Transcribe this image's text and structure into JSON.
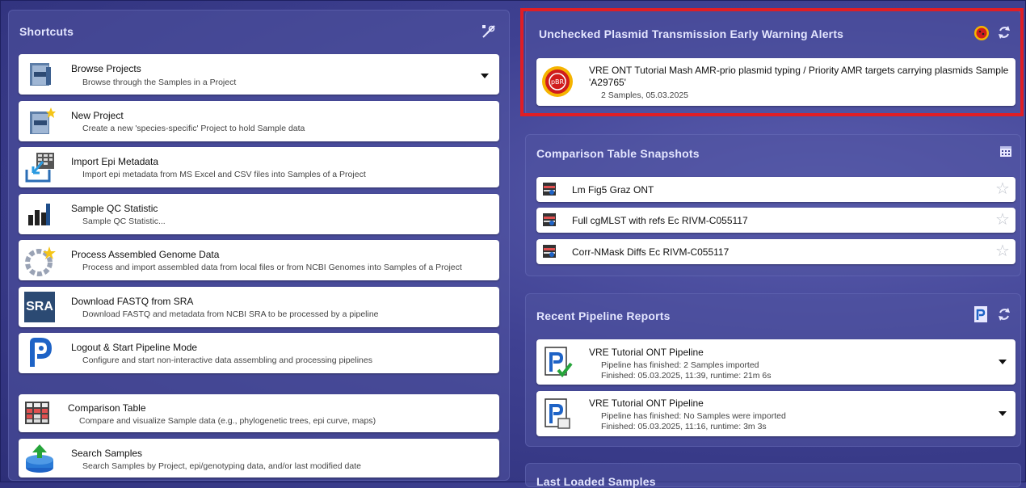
{
  "shortcuts": {
    "title": "Shortcuts",
    "items": [
      {
        "title": "Browse Projects",
        "desc": "Browse through the Samples in a Project",
        "icon": "browse-projects-icon"
      },
      {
        "title": "New Project",
        "desc": "Create a new 'species-specific' Project to hold Sample data",
        "icon": "new-project-icon"
      },
      {
        "title": "Import Epi Metadata",
        "desc": "Import epi metadata from MS Excel and CSV files into Samples of a Project",
        "icon": "import-epi-icon"
      },
      {
        "title": "Sample QC Statistic",
        "desc": "Sample QC Statistic...",
        "icon": "bar-chart-icon"
      },
      {
        "title": "Process Assembled Genome Data",
        "desc": "Process and import assembled data from local files or from NCBI Genomes into Samples of a Project",
        "icon": "genome-icon"
      },
      {
        "title": "Download FASTQ from SRA",
        "desc": "Download FASTQ and metadata from NCBI SRA to be processed by a pipeline",
        "icon": "sra-icon",
        "icon_text": "SRA"
      },
      {
        "title": "Logout & Start Pipeline Mode",
        "desc": "Configure and start non-interactive data assembling and processing pipelines",
        "icon": "pipeline-icon"
      },
      {
        "title": "Comparison Table",
        "desc": "Compare and visualize Sample data (e.g., phylogenetic trees, epi curve, maps)",
        "icon": "table-icon"
      },
      {
        "title": "Search Samples",
        "desc": "Search Samples by Project, epi/genotyping data, and/or last modified date",
        "icon": "database-search-icon"
      }
    ]
  },
  "alerts": {
    "title": "Unchecked Plasmid Transmission Early Warning Alerts",
    "item": {
      "title": "VRE ONT Tutorial Mash AMR-prio plasmid typing / Priority AMR targets carrying plasmids Sample 'A29765'",
      "meta": "2 Samples, 05.03.2025",
      "badge": "pBR"
    }
  },
  "snapshots": {
    "title": "Comparison Table Snapshots",
    "items": [
      {
        "label": "Lm Fig5 Graz ONT"
      },
      {
        "label": "Full cgMLST with refs Ec RIVM-C055117"
      },
      {
        "label": "Corr-NMask Diffs Ec RIVM-C055117"
      }
    ]
  },
  "reports": {
    "title": "Recent Pipeline Reports",
    "items": [
      {
        "title": "VRE Tutorial ONT Pipeline",
        "line1": "Pipeline has finished: 2 Samples imported",
        "line2": "Finished: 05.03.2025, 11:39, runtime: 21m 6s"
      },
      {
        "title": "VRE Tutorial ONT Pipeline",
        "line1": "Pipeline has finished: No Samples were imported",
        "line2": "Finished: 05.03.2025, 11:16, runtime: 3m 3s"
      }
    ]
  },
  "last_loaded": {
    "title": "Last Loaded Samples"
  },
  "colors": {
    "alert_border": "#e01e25",
    "background": "#3f4192"
  }
}
